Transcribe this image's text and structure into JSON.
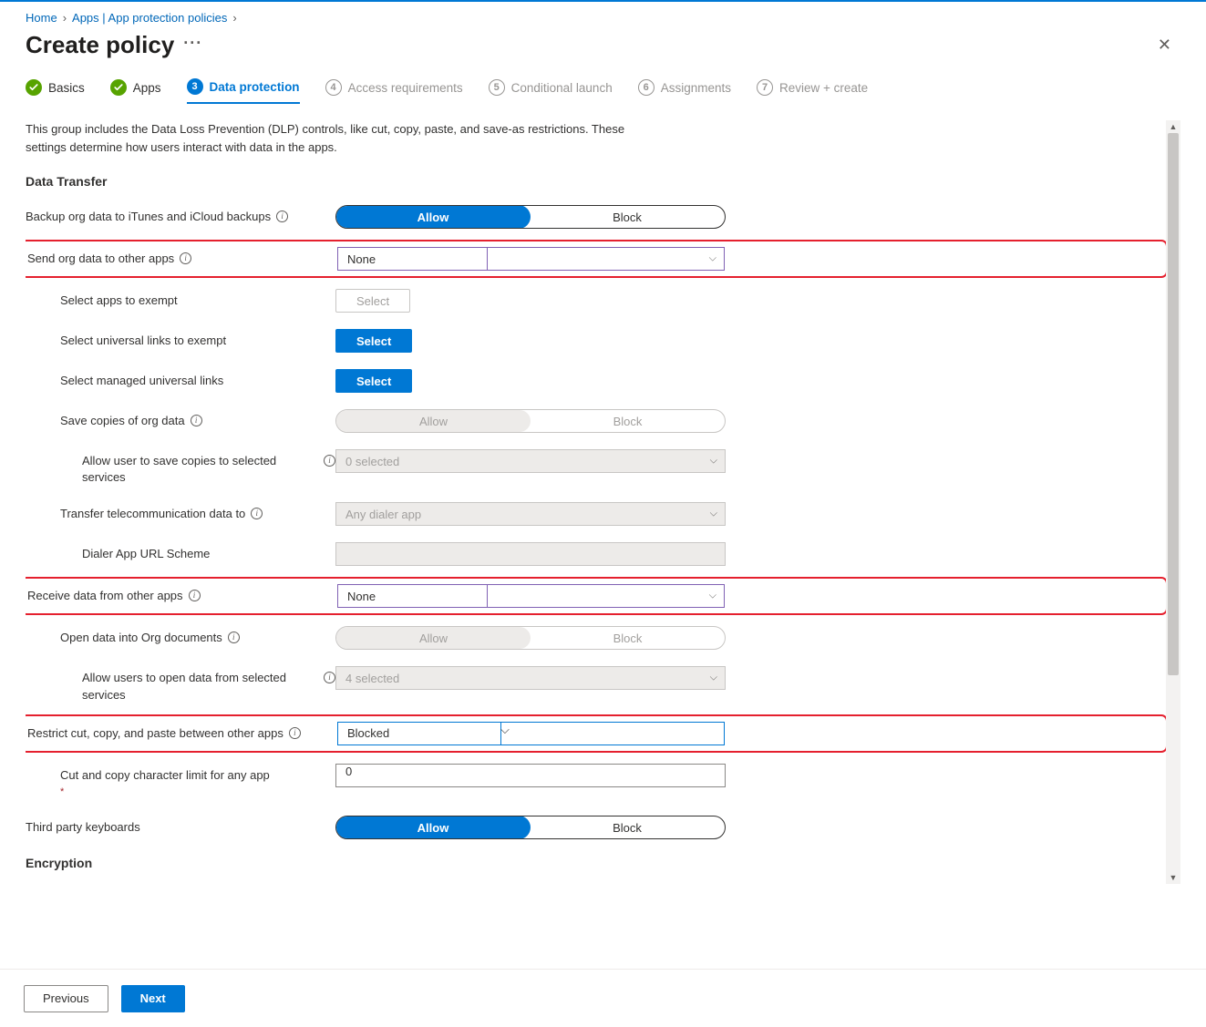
{
  "breadcrumb": {
    "home": "Home",
    "apps": "Apps | App protection policies"
  },
  "page": {
    "title": "Create policy"
  },
  "steps": {
    "s1": {
      "label": "Basics"
    },
    "s2": {
      "label": "Apps"
    },
    "s3": {
      "num": "3",
      "label": "Data protection"
    },
    "s4": {
      "num": "4",
      "label": "Access requirements"
    },
    "s5": {
      "num": "5",
      "label": "Conditional launch"
    },
    "s6": {
      "num": "6",
      "label": "Assignments"
    },
    "s7": {
      "num": "7",
      "label": "Review + create"
    }
  },
  "desc": "This group includes the Data Loss Prevention (DLP) controls, like cut, copy, paste, and save-as restrictions. These settings determine how users interact with data in the apps.",
  "sections": {
    "transfer": "Data Transfer",
    "encryption": "Encryption"
  },
  "labels": {
    "backup": "Backup org data to iTunes and iCloud backups",
    "send": "Send org data to other apps",
    "exempt_apps": "Select apps to exempt",
    "exempt_links": "Select universal links to exempt",
    "managed_links": "Select managed universal links",
    "save_copies": "Save copies of org data",
    "save_services": "Allow user to save copies to selected services",
    "telecom": "Transfer telecommunication data to",
    "dialer": "Dialer App URL Scheme",
    "receive": "Receive data from other apps",
    "open_org": "Open data into Org documents",
    "open_services": "Allow users to open data from selected services",
    "restrict": "Restrict cut, copy, and paste between other apps",
    "charlimit": "Cut and copy character limit for any app",
    "keyboards": "Third party keyboards"
  },
  "values": {
    "allow": "Allow",
    "block": "Block",
    "none": "None",
    "select_btn": "Select",
    "zero_selected": "0 selected",
    "any_dialer": "Any dialer app",
    "four_selected": "4 selected",
    "blocked": "Blocked",
    "zero": "0"
  },
  "footer": {
    "prev": "Previous",
    "next": "Next"
  }
}
